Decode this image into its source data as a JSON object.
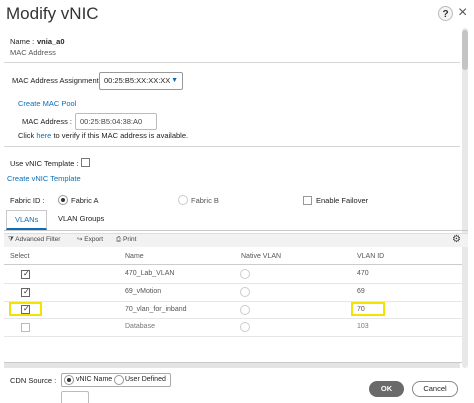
{
  "dialog": {
    "title": "Modify vNIC",
    "help_glyph": "?",
    "close_glyph": "×"
  },
  "name_field": {
    "label": "Name :",
    "value": "vnia_a0"
  },
  "mac_section": {
    "heading": "MAC Address",
    "assignment_label": "MAC Address Assignment:",
    "assignment_value": "00:25:B5:XX:XX:XX",
    "create_pool_link": "Create MAC Pool",
    "mac_label": "MAC Address :",
    "mac_value": "00:25:B5:04:38:A0",
    "verify_prefix": "Click",
    "verify_link": "here",
    "verify_suffix": "to verify if this MAC address is available."
  },
  "template": {
    "label": "Use vNIC Template :",
    "checked": false,
    "create_link": "Create vNIC Template"
  },
  "fabric": {
    "label": "Fabric ID :",
    "option_a": "Fabric A",
    "option_b": "Fabric B",
    "failover_label": "Enable Failover",
    "selected": "Fabric A"
  },
  "tabs": [
    {
      "label": "VLANs",
      "active": true
    },
    {
      "label": "VLAN Groups",
      "active": false
    }
  ],
  "toolbar": {
    "filter_label": "Advanced Filter",
    "export_label": "Export",
    "print_label": "Print"
  },
  "table": {
    "headers": [
      "Select",
      "Name",
      "Native VLAN",
      "VLAN ID"
    ],
    "rows": [
      {
        "name": "470_Lab_VLAN",
        "vlan_id": "470",
        "selected": true,
        "native": false
      },
      {
        "name": "69_vMotion",
        "vlan_id": "69",
        "selected": true,
        "native": false
      },
      {
        "name": "70_vlan_for_inband",
        "vlan_id": "70",
        "selected": true,
        "native": false
      },
      {
        "name": "Database",
        "vlan_id": "103",
        "selected": false,
        "native": false
      }
    ]
  },
  "cdn": {
    "label": "CDN Source :",
    "option_vnic": "vNIC Name",
    "option_user": "User Defined",
    "selected": "vNIC Name"
  },
  "footer": {
    "ok_label": "OK",
    "cancel_label": "Cancel"
  },
  "colors": {
    "link": "#0a6fb8",
    "highlight": "#f2e400",
    "ok_button": "#6a6a6a"
  }
}
